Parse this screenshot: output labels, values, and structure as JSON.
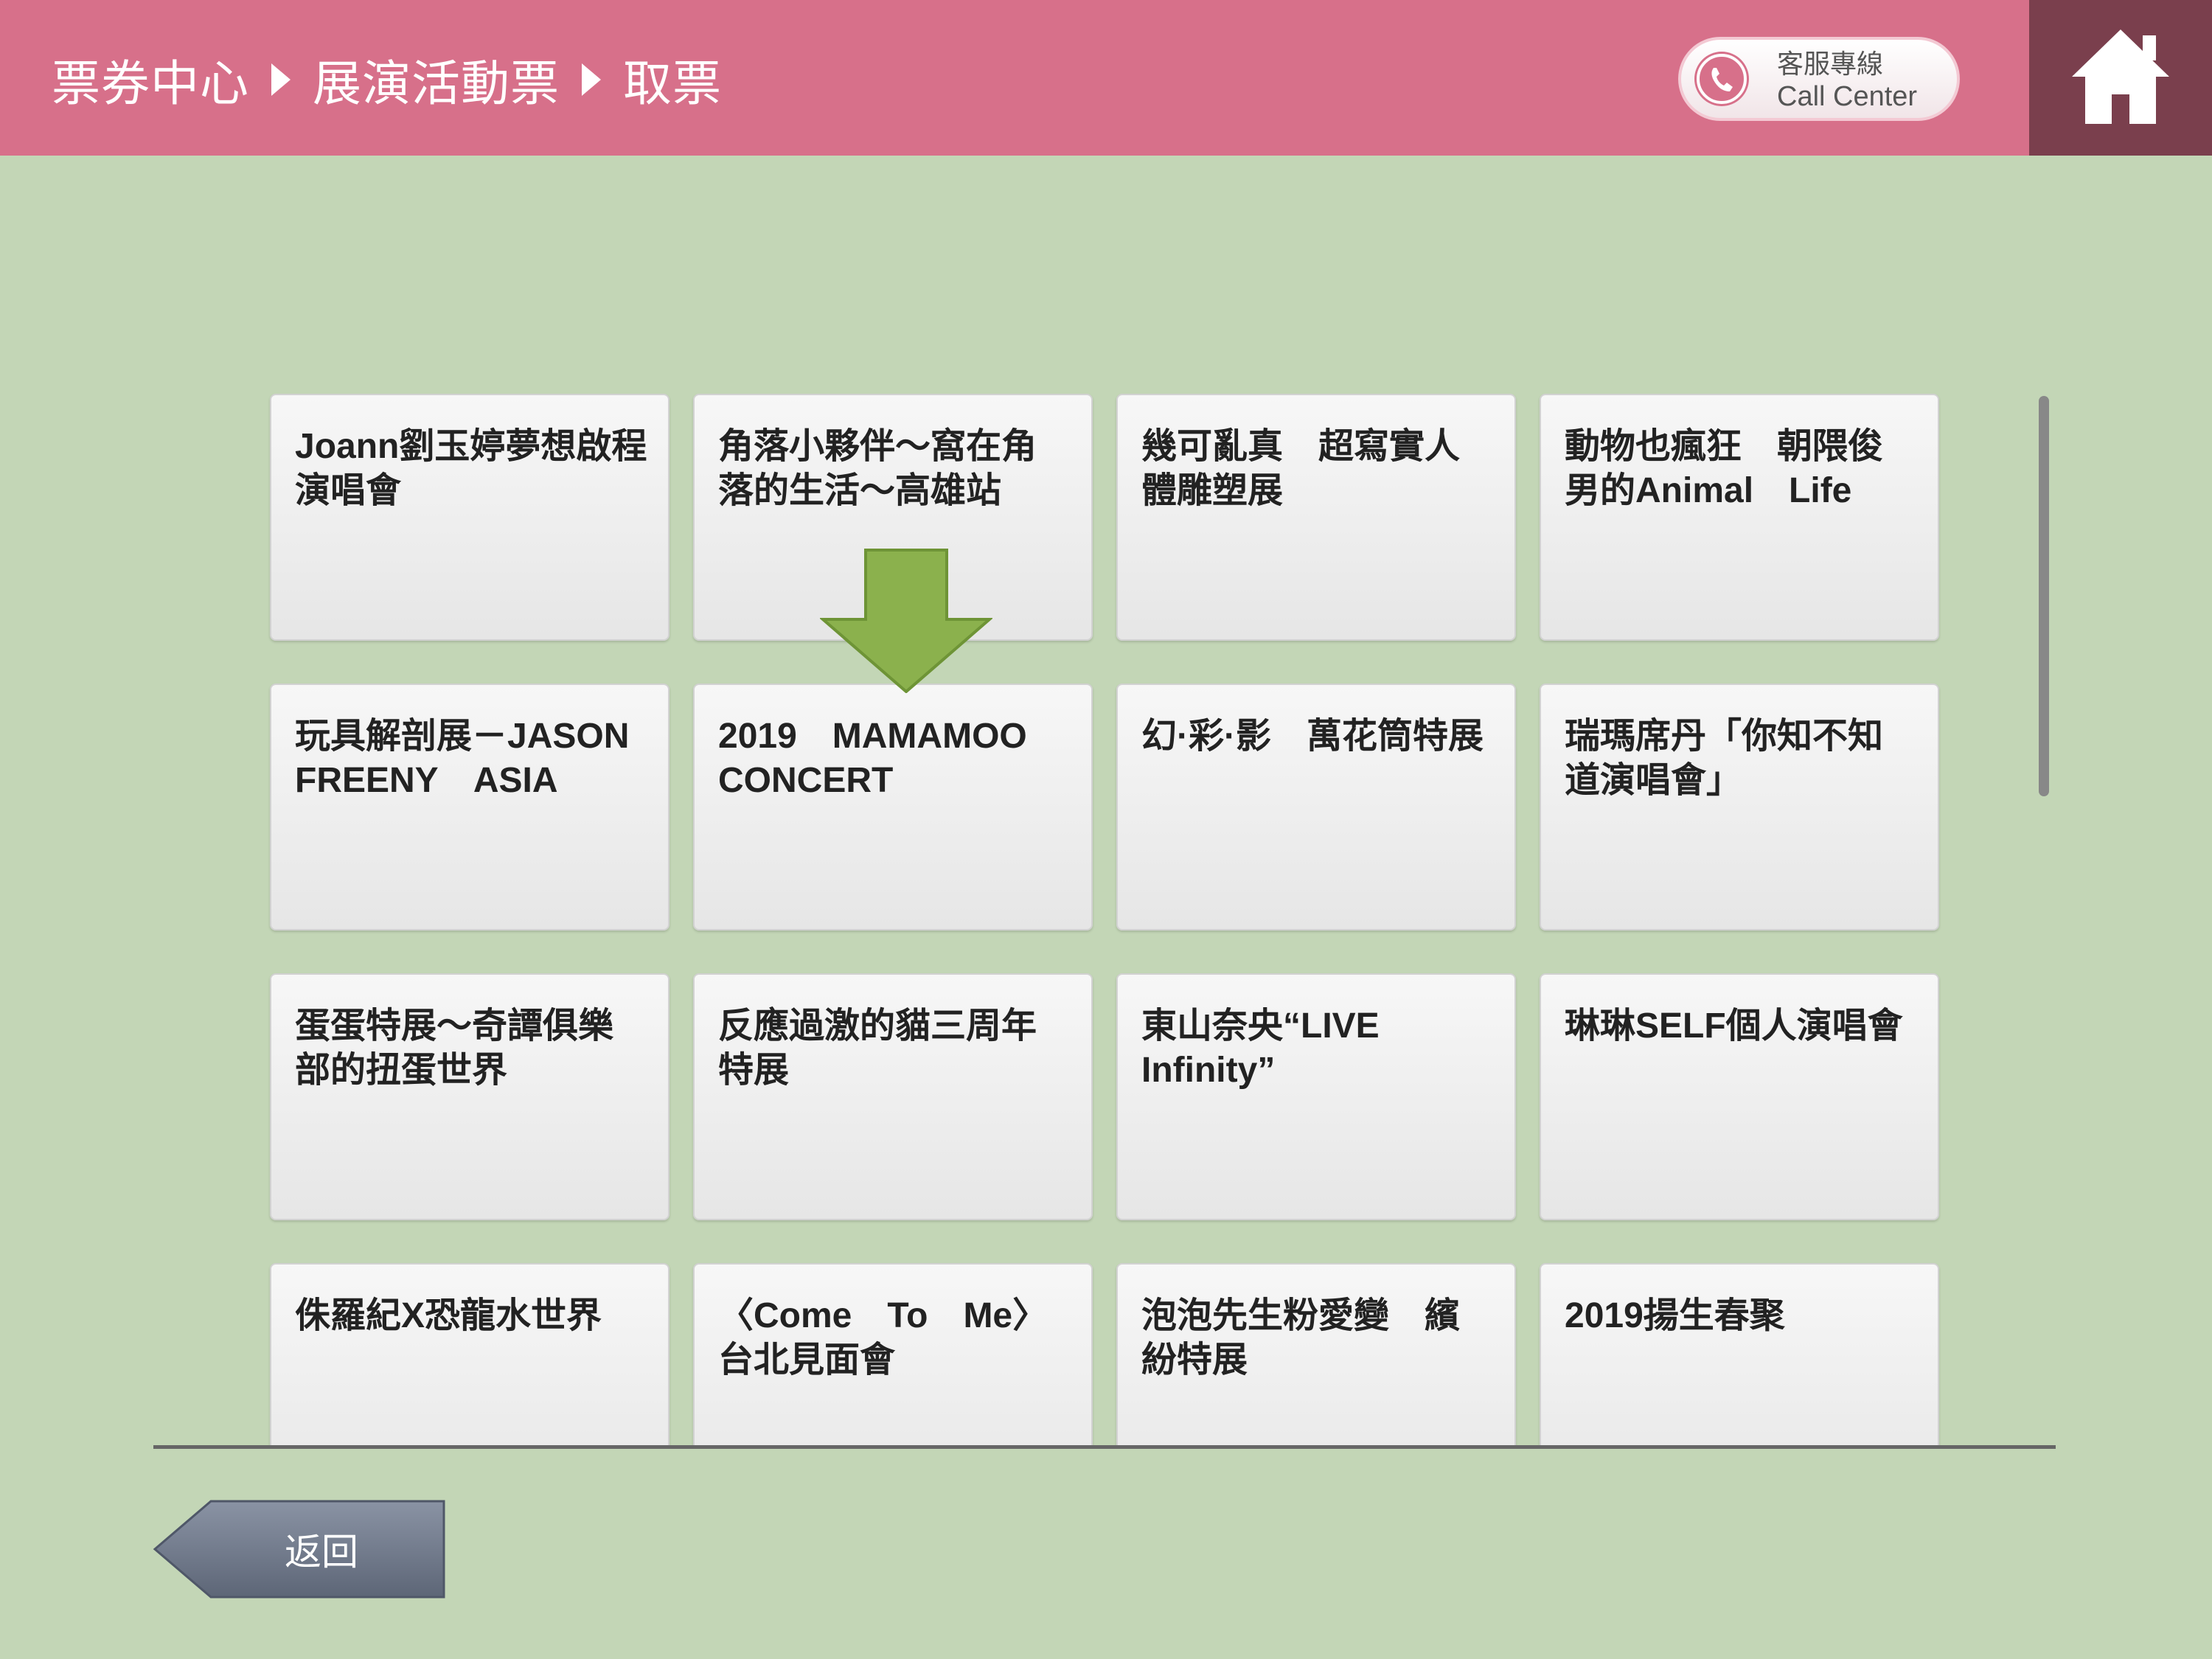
{
  "header": {
    "breadcrumb": [
      "票券中心",
      "展演活動票",
      "取票"
    ],
    "call_center": {
      "title": "客服專線",
      "subtitle": "Call Center"
    },
    "colors": {
      "header_bg": "#d7708a",
      "home_bg": "#7a3f4d",
      "page_bg": "#c3d6b6"
    }
  },
  "events": [
    "Joann劉玉婷夢想啟程演唱會",
    "角落小夥伴～窩在角落的生活～高雄站",
    "幾可亂真　超寫實人體雕塑展",
    "動物也瘋狂　朝隈俊男的Animal　Life",
    "玩具解剖展－JASON FREENY　ASIA",
    "2019　MAMAMOO CONCERT",
    "幻·彩·影　萬花筒特展",
    "瑞瑪席丹「你知不知道演唱會」",
    "蛋蛋特展～奇譚俱樂部的扭蛋世界",
    "反應過激的貓三周年特展",
    "東山奈央“LIVE Infinity”",
    "琳琳SELF個人演唱會",
    "侏羅紀X恐龍水世界",
    "〈Come　To　Me〉台北見面會",
    "泡泡先生粉愛變　繽紛特展",
    "2019揚生春聚"
  ],
  "footer": {
    "back_label": "返回"
  },
  "icons": [
    "phone-icon",
    "home-icon",
    "down-arrow-icon",
    "back-arrow-button"
  ]
}
